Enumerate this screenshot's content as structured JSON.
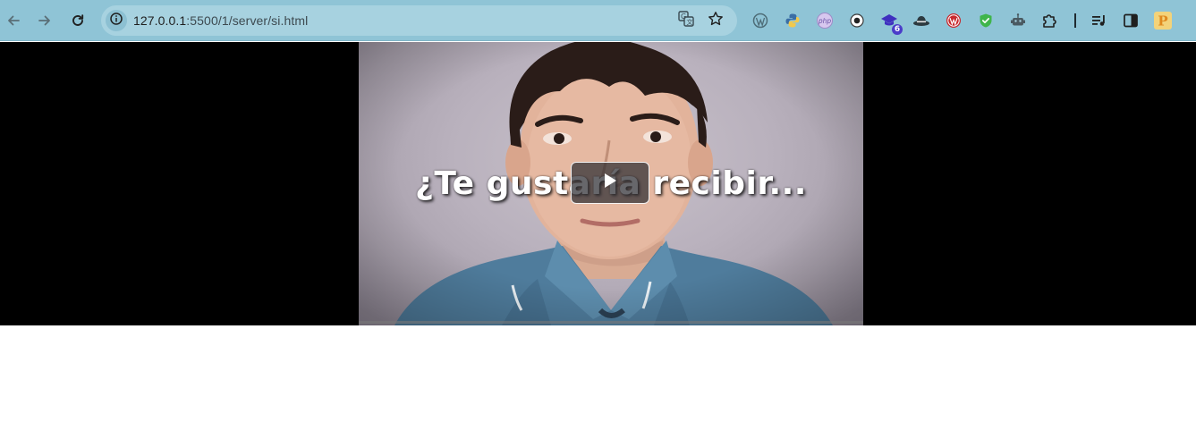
{
  "browser": {
    "nav": {
      "back_icon": "arrow-left-icon",
      "forward_icon": "arrow-right-icon",
      "reload_icon": "reload-icon"
    },
    "omnibox": {
      "site_info_icon": "info-icon",
      "url_host": "127.0.0.1",
      "url_rest": ":5500/1/server/si.html",
      "translate_icon": "translate-icon",
      "bookmark_icon": "star-icon"
    },
    "extensions": [
      {
        "name": "wordpress-icon"
      },
      {
        "name": "python-icon"
      },
      {
        "name": "php-icon",
        "label": "php"
      },
      {
        "name": "record-icon"
      },
      {
        "name": "graduation-cap-icon",
        "badge": "6"
      },
      {
        "name": "hat-icon"
      },
      {
        "name": "wordpress-red-icon"
      },
      {
        "name": "shield-check-icon"
      },
      {
        "name": "robot-icon"
      },
      {
        "name": "puzzle-icon"
      },
      {
        "name": "media-queue-icon"
      },
      {
        "name": "side-panel-icon"
      },
      {
        "name": "profile-icon",
        "label": "P"
      }
    ],
    "colors": {
      "toolbar": "#8fc4d6",
      "omnibox": "#a7d2e0"
    }
  },
  "page": {
    "video": {
      "caption": "¿Te gustaría recibir...",
      "play_icon": "play-icon",
      "progress": 0.0
    },
    "colors": {
      "stage": "#000000",
      "background": "#ffffff"
    }
  }
}
